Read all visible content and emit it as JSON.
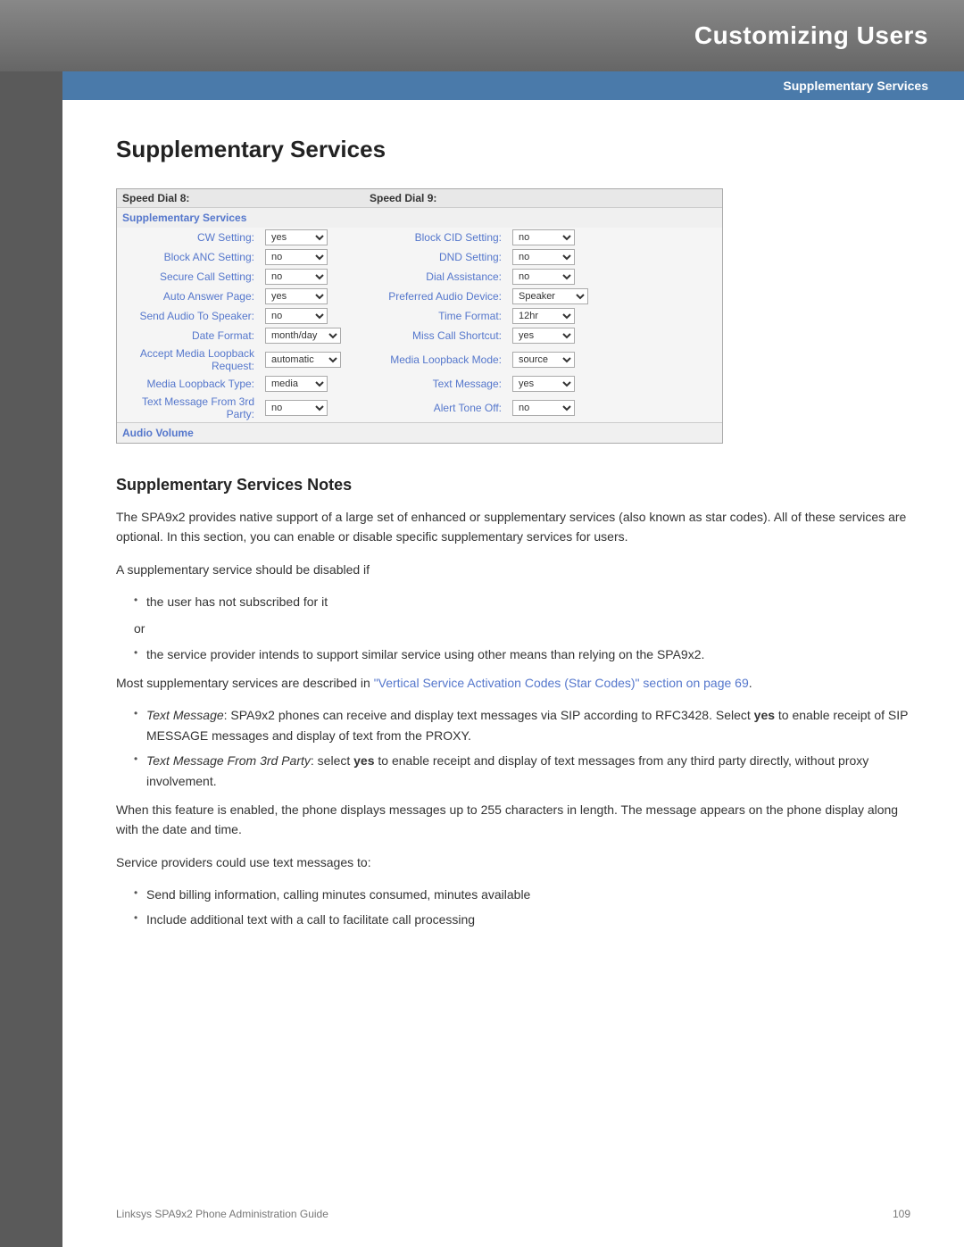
{
  "header": {
    "title": "Customizing Users",
    "subtitle": "Supplementary Services"
  },
  "page": {
    "title": "Supplementary Services",
    "section_notes_title": "Supplementary Services Notes"
  },
  "table": {
    "speed_dial_8": "Speed Dial 8:",
    "speed_dial_9": "Speed Dial 9:",
    "supplementary_services_label": "Supplementary Services",
    "rows": [
      {
        "left_label": "CW Setting:",
        "left_value": "yes",
        "right_label": "Block CID Setting:",
        "right_value": "no"
      },
      {
        "left_label": "Block ANC Setting:",
        "left_value": "no",
        "right_label": "DND Setting:",
        "right_value": "no"
      },
      {
        "left_label": "Secure Call Setting:",
        "left_value": "no",
        "right_label": "Dial Assistance:",
        "right_value": "no"
      },
      {
        "left_label": "Auto Answer Page:",
        "left_value": "yes",
        "right_label": "Preferred Audio Device:",
        "right_value": "Speaker"
      },
      {
        "left_label": "Send Audio To Speaker:",
        "left_value": "no",
        "right_label": "Time Format:",
        "right_value": "12hr"
      },
      {
        "left_label": "Date Format:",
        "left_value": "month/day",
        "right_label": "Miss Call Shortcut:",
        "right_value": "yes"
      },
      {
        "left_label": "Accept Media Loopback Request:",
        "left_value": "automatic",
        "right_label": "Media Loopback Mode:",
        "right_value": "source"
      },
      {
        "left_label": "Media Loopback Type:",
        "left_value": "media",
        "right_label": "Text Message:",
        "right_value": "yes"
      },
      {
        "left_label": "Text Message From 3rd Party:",
        "left_value": "no",
        "right_label": "Alert Tone Off:",
        "right_value": "no"
      }
    ],
    "audio_volume_label": "Audio Volume"
  },
  "notes": {
    "para1": "The SPA9x2 provides native support of a large set of enhanced or supplementary services (also known as star codes). All of these services are optional. In this section, you can enable or disable specific supplementary services for users.",
    "para2": "A supplementary service should be disabled if",
    "bullet1": "the user has not subscribed for it",
    "or_text": "or",
    "bullet2": "the service provider intends to support similar service using other means than relying on the SPA9x2.",
    "para3_before_link": "Most supplementary services are described in ",
    "link_text": "\"Vertical Service Activation Codes (Star Codes)\" section on page 69",
    "para3_after_link": ".",
    "bullet3_italic": "Text Message",
    "bullet3_text": ": SPA9x2 phones can receive and display text messages via SIP according to RFC3428. Select ",
    "bullet3_bold": "yes",
    "bullet3_text2": " to enable receipt of SIP MESSAGE messages and display of text from the PROXY.",
    "bullet4_italic": "Text Message From 3rd Party",
    "bullet4_text": ": select ",
    "bullet4_bold": "yes",
    "bullet4_text2": " to enable receipt and display of text messages from any third party directly, without proxy involvement.",
    "para4": "When this feature is enabled, the phone displays messages up to 255 characters in length. The message appears on the phone display along with the date and time.",
    "para5": "Service providers could use text messages to:",
    "bullet5": "Send billing information, calling minutes consumed, minutes available",
    "bullet6": "Include additional text with a call to facilitate call processing"
  },
  "footer": {
    "left": "Linksys SPA9x2 Phone Administration Guide",
    "right": "109"
  }
}
